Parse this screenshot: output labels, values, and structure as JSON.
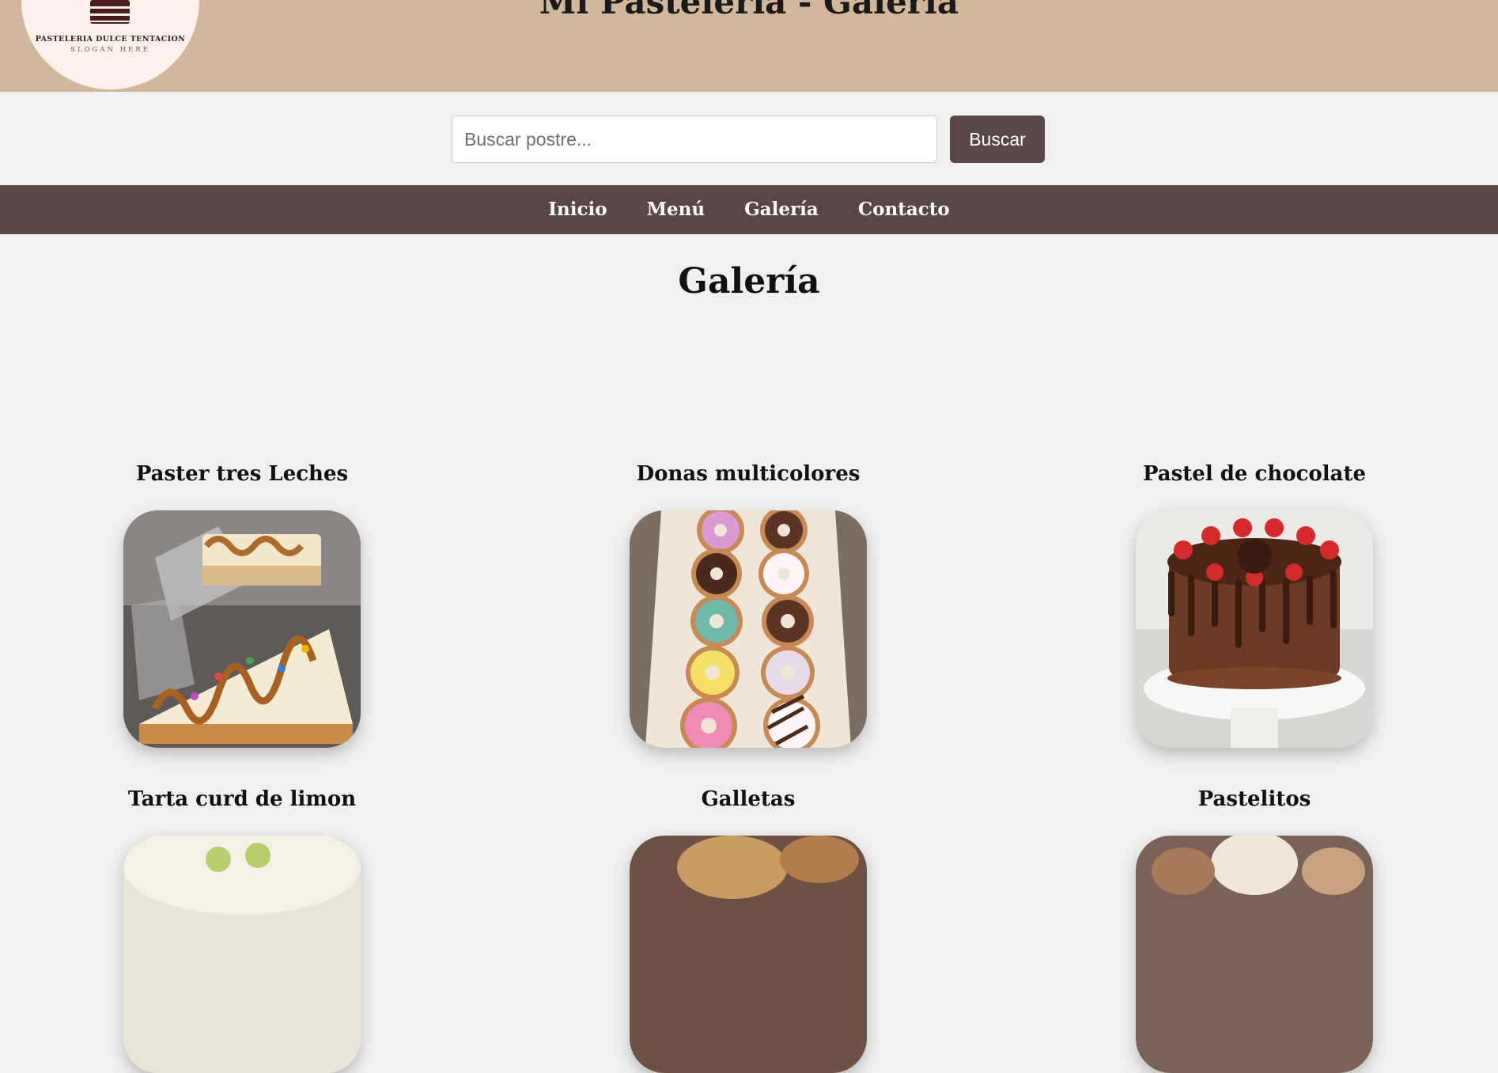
{
  "header": {
    "title": "Mi Pastelería - Galería",
    "logo": {
      "name": "PASTELERIA DULCE TENTACION",
      "slogan": "SLOGAN HERE",
      "icon": "cake-slice-icon"
    }
  },
  "search": {
    "placeholder": "Buscar postre...",
    "value": "",
    "button_label": "Buscar"
  },
  "nav": {
    "items": [
      {
        "label": "Inicio"
      },
      {
        "label": "Menú"
      },
      {
        "label": "Galería"
      },
      {
        "label": "Contacto"
      }
    ]
  },
  "main": {
    "title": "Galería",
    "gallery": [
      {
        "title": "Paster tres Leches",
        "image": "tres-leches-photo"
      },
      {
        "title": "Donas multicolores",
        "image": "donuts-photo"
      },
      {
        "title": "Pastel de chocolate",
        "image": "chocolate-cake-photo"
      },
      {
        "title": "Tarta curd de limon",
        "image": "lemon-tart-photo"
      },
      {
        "title": "Galletas",
        "image": "cookies-photo"
      },
      {
        "title": "Pastelitos",
        "image": "cupcakes-photo"
      }
    ]
  },
  "colors": {
    "header_bg": "#d2b79b",
    "nav_bg": "#5b4646",
    "page_bg": "#f0f0f0",
    "button_bg": "#5b4646"
  }
}
